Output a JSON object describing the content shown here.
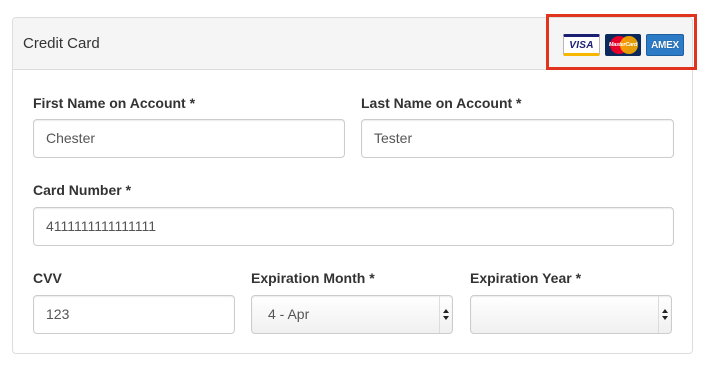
{
  "panel": {
    "title": "Credit Card"
  },
  "card_logos": [
    {
      "name": "visa-logo",
      "label": "VISA",
      "color": "#1a1f71"
    },
    {
      "name": "mastercard-logo",
      "label": "MasterCard",
      "color": "#e4002b"
    },
    {
      "name": "amex-logo",
      "label": "AMEX",
      "color": "#2b7bc6"
    }
  ],
  "highlight_color": "#e0341f",
  "form": {
    "first_name": {
      "label": "First Name on Account *",
      "value": "Chester"
    },
    "last_name": {
      "label": "Last Name on Account *",
      "value": "Tester"
    },
    "card_number": {
      "label": "Card Number *",
      "value": "4111111111111111"
    },
    "cvv": {
      "label": "CVV",
      "value": "123"
    },
    "expiration_month": {
      "label": "Expiration Month *",
      "selected": "4 - Apr"
    },
    "expiration_year": {
      "label": "Expiration Year *",
      "selected": ""
    }
  }
}
